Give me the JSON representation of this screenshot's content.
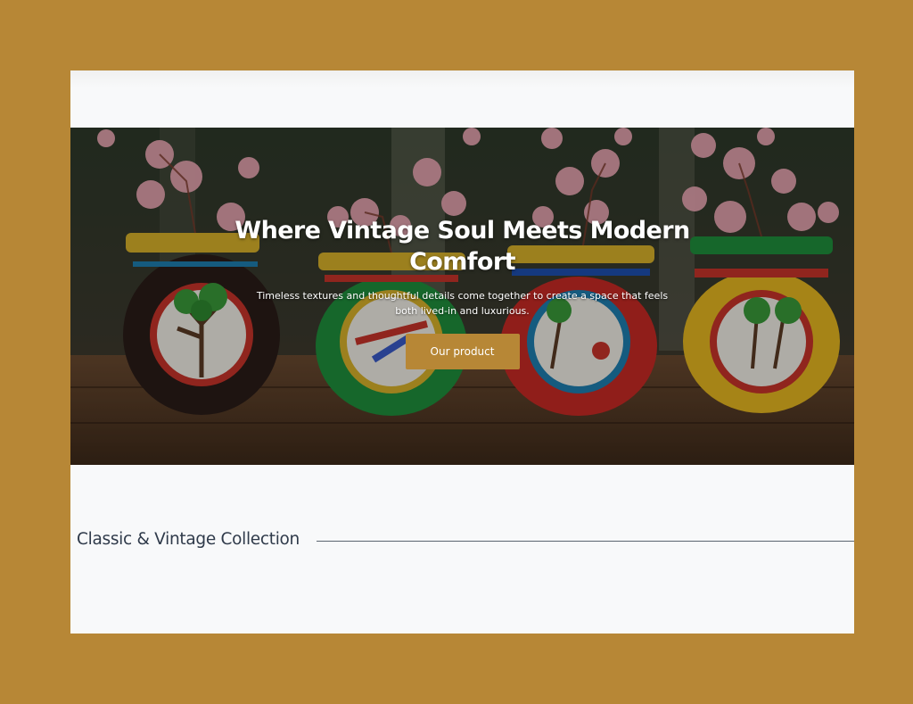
{
  "hero": {
    "title": "Where Vintage Soul Meets Modern Comfort",
    "subtitle": "Timeless textures and thoughtful details come together to create a space that feels both lived-in and luxurious.",
    "cta_label": "Our product",
    "image": "painted clay pots with pink blossoms on a wooden table"
  },
  "collection": {
    "heading": "Classic & Vintage Collection"
  },
  "colors": {
    "page_background": "#b78736",
    "accent": "#b78736",
    "surface": "#f8f9fa",
    "heading_text": "#2f3a4a"
  }
}
